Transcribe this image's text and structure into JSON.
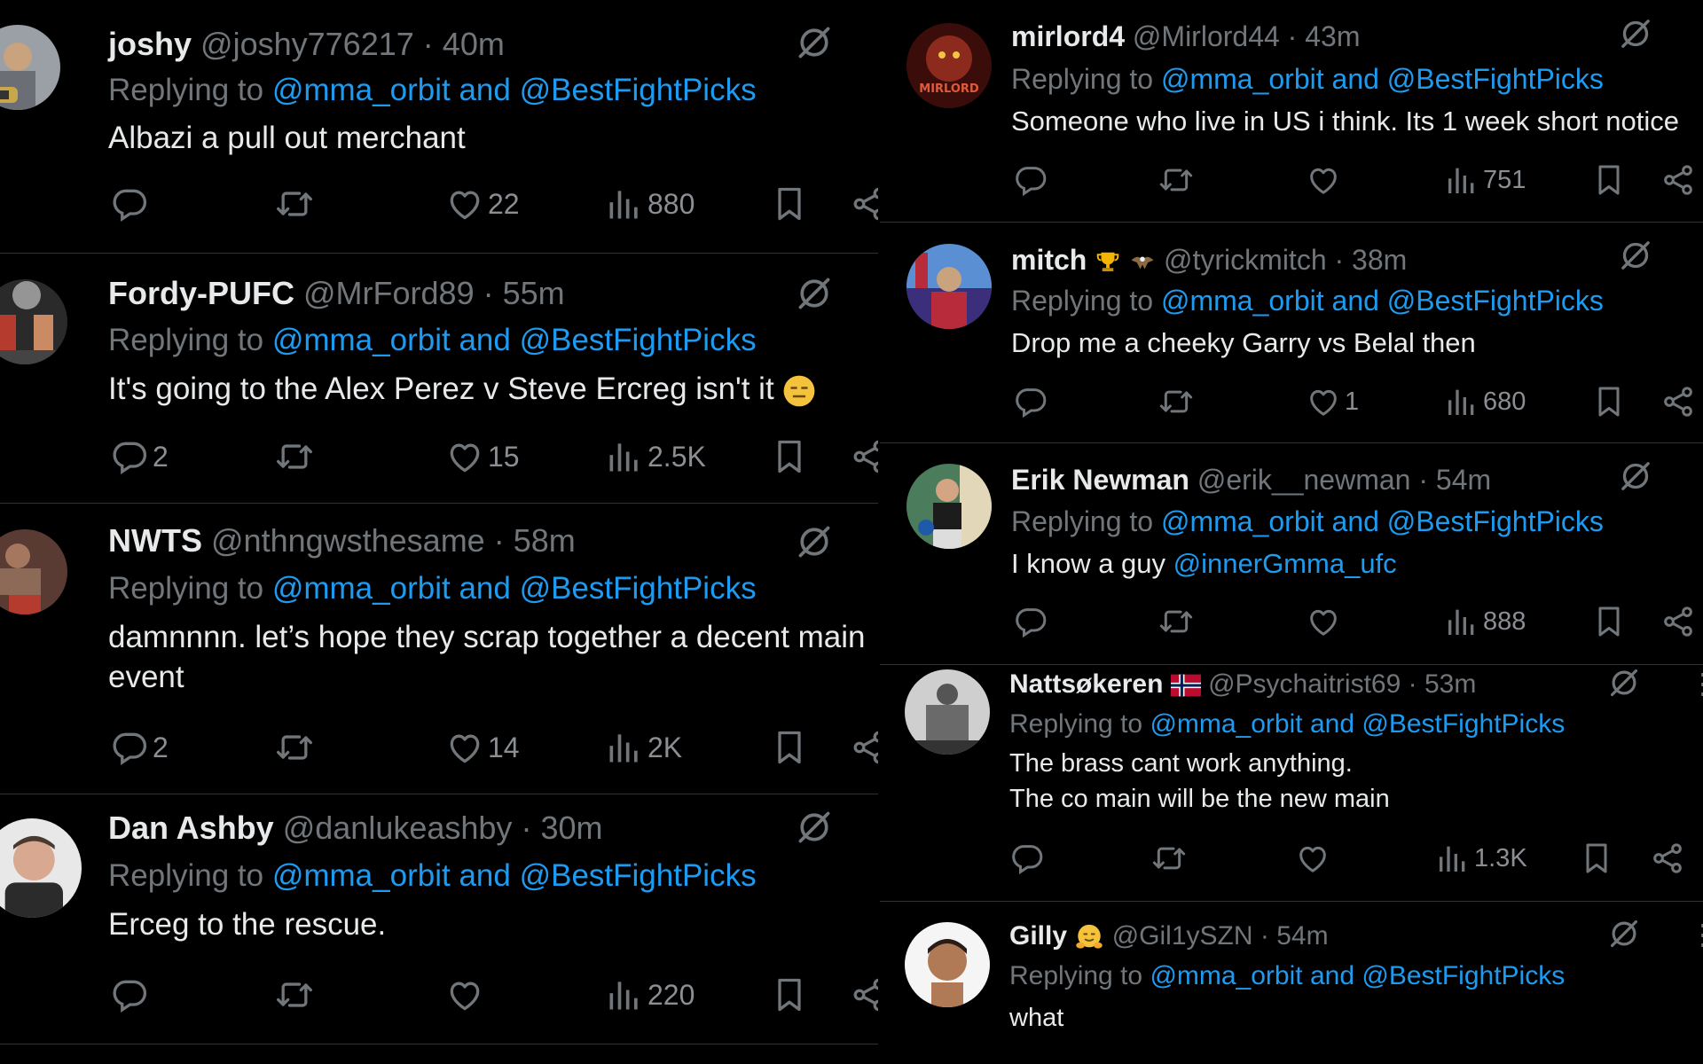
{
  "left": [
    {
      "name": "joshy",
      "handle": "@joshy776217",
      "time": "40m",
      "replying_prefix": "Replying to",
      "mention1": "@mma_orbit",
      "and": "and",
      "mention2": "@BestFightPicks",
      "text": "Albazi a pull out merchant",
      "counts": {
        "replies": "",
        "reposts": "",
        "likes": "22",
        "views": "880"
      }
    },
    {
      "name": "Fordy-PUFC",
      "handle": "@MrFord89",
      "time": "55m",
      "replying_prefix": "Replying to",
      "mention1": "@mma_orbit",
      "and": "and",
      "mention2": "@BestFightPicks",
      "text": "It's going to the Alex Perez v Steve Ercreg isn't it",
      "counts": {
        "replies": "2",
        "reposts": "",
        "likes": "15",
        "views": "2.5K"
      }
    },
    {
      "name": "NWTS",
      "handle": "@nthngwsthesame",
      "time": "58m",
      "replying_prefix": "Replying to",
      "mention1": "@mma_orbit",
      "and": "and",
      "mention2": "@BestFightPicks",
      "text_line1": "damnnnn. let’s hope they scrap together a decent main",
      "text_line2": "event",
      "counts": {
        "replies": "2",
        "reposts": "",
        "likes": "14",
        "views": "2K"
      }
    },
    {
      "name": "Dan Ashby",
      "handle": "@danlukeashby",
      "time": "30m",
      "replying_prefix": "Replying to",
      "mention1": "@mma_orbit",
      "and": "and",
      "mention2": "@BestFightPicks",
      "text": "Erceg to the rescue.",
      "counts": {
        "replies": "",
        "reposts": "",
        "likes": "",
        "views": "220"
      }
    }
  ],
  "right": [
    {
      "name": "mirlord4",
      "handle": "@Mirlord44",
      "time": "43m",
      "replying_prefix": "Replying to",
      "mention1": "@mma_orbit",
      "and": "and",
      "mention2": "@BestFightPicks",
      "text": "Someone who live in US i think. Its 1 week short notice",
      "counts": {
        "replies": "",
        "reposts": "",
        "likes": "",
        "views": "751"
      },
      "avatar_text": "MIRLORD"
    },
    {
      "name": "mitch",
      "handle": "@tyrickmitch",
      "time": "38m",
      "replying_prefix": "Replying to",
      "mention1": "@mma_orbit",
      "and": "and",
      "mention2": "@BestFightPicks",
      "text": "Drop me a cheeky Garry vs Belal then",
      "counts": {
        "replies": "",
        "reposts": "",
        "likes": "1",
        "views": "680"
      }
    },
    {
      "name": "Erik Newman",
      "handle": "@erik__newman",
      "time": "54m",
      "replying_prefix": "Replying to",
      "mention1": "@mma_orbit",
      "and": "and",
      "mention2": "@BestFightPicks",
      "text_prefix": "I know a guy",
      "text_link": "@innerGmma_ufc",
      "counts": {
        "replies": "",
        "reposts": "",
        "likes": "",
        "views": "888"
      }
    },
    {
      "name": "Nattsøkeren",
      "handle": "@Psychaitrist69",
      "time": "53m",
      "replying_prefix": "Replying to",
      "mention1": "@mma_orbit",
      "and": "and",
      "mention2": "@BestFightPicks",
      "text_line1": "The brass cant work anything.",
      "text_line2": "The co main will be the new main",
      "counts": {
        "replies": "",
        "reposts": "",
        "likes": "",
        "views": "1.3K"
      }
    },
    {
      "name": "Gilly",
      "handle": "@Gil1ySZN",
      "time": "54m",
      "replying_prefix": "Replying to",
      "mention1": "@mma_orbit",
      "and": "and",
      "mention2": "@BestFightPicks",
      "text": "what"
    }
  ],
  "separator": "·",
  "icons": [
    "reply-icon",
    "repost-icon",
    "like-icon",
    "views-icon",
    "bookmark-icon",
    "share-icon",
    "grok-icon",
    "more-icon"
  ],
  "colors": {
    "background": "#000000",
    "text": "#e7e9ea",
    "muted": "#71767b",
    "link": "#1d9bf0",
    "divider": "#2f3336"
  }
}
